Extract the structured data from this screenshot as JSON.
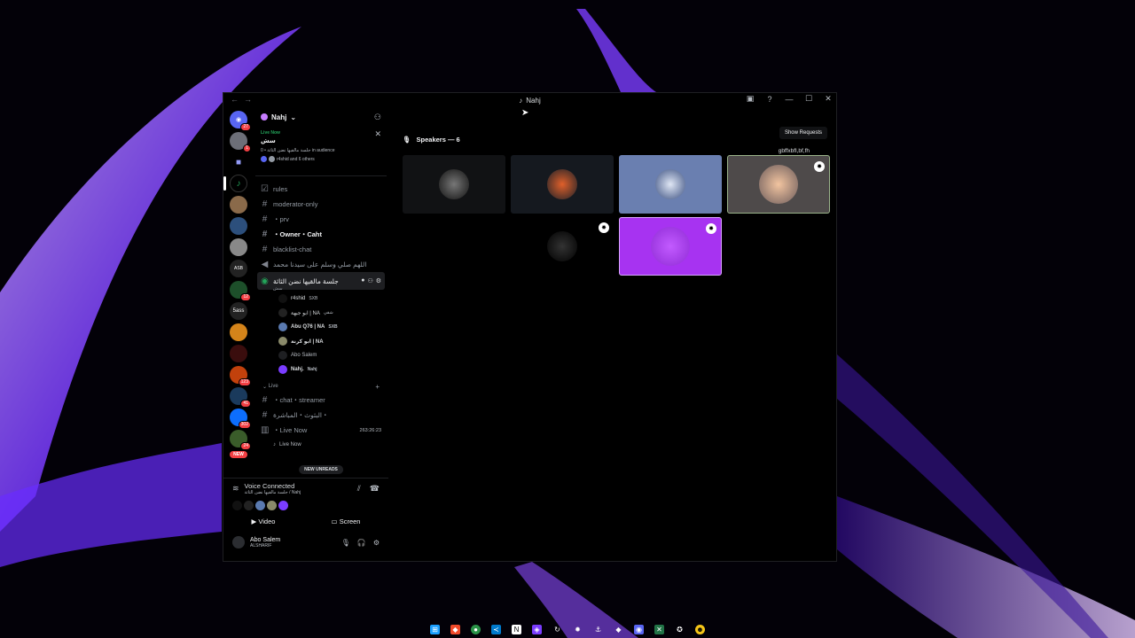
{
  "window": {
    "title": "Nahj"
  },
  "server": {
    "name": "Nahj"
  },
  "live_card": {
    "label": "Live Now",
    "stage_name": "سش",
    "meta": "جلسة مالقيها نضن الثاثة • 0 in audience",
    "others": "r4shid and 6 others"
  },
  "rail": {
    "badges": [
      "27",
      "1",
      "5",
      "12",
      "123",
      "41",
      "302",
      "24"
    ],
    "text_server": "5ass",
    "new_label": "NEW"
  },
  "channels": [
    {
      "icon": "rules",
      "label": "rules"
    },
    {
      "icon": "hash",
      "label": "moderator-only"
    },
    {
      "icon": "hash",
      "label": "・prv"
    },
    {
      "icon": "hash",
      "label": "・Owner・Caht"
    },
    {
      "icon": "hash",
      "label": "blacklist-chat"
    },
    {
      "icon": "hash",
      "label": "اللهم صلي وسلم على سيدنا محمد"
    }
  ],
  "active_channel": {
    "label": "جلسة مالقيها نضن الثاثة",
    "sub": "سش"
  },
  "members": [
    {
      "name": "r4shid",
      "tag": "SXB"
    },
    {
      "name": "ابو جبهة | NA",
      "tag": "شقي"
    },
    {
      "name": "Abu Q76 | NA",
      "tag": "SXB"
    },
    {
      "name": "ابو كرنة | NA",
      "tag": ""
    },
    {
      "name": "Abo Salem",
      "tag": ""
    },
    {
      "name": "Nahj.",
      "tag": "Nahj"
    }
  ],
  "category": {
    "label": "Live"
  },
  "live_channels": [
    {
      "label": "・chat・streamer",
      "timer": ""
    },
    {
      "label": "البثوث・المباشرة・",
      "timer": ""
    },
    {
      "label": "・Live Now",
      "timer": "263:26:23"
    }
  ],
  "live_now_sub": "Live Now",
  "new_unreads": "NEW UNREADS",
  "voice": {
    "title": "Voice Connected",
    "sub": "جلسة مالقيها نضن الثاثة / Nahj",
    "video_label": "Video",
    "screen_label": "Screen"
  },
  "user": {
    "name": "Abo Salem",
    "status": "ALSHARIF"
  },
  "stage": {
    "speakers_label": "Speakers — 6",
    "tooltip": "Show Requests",
    "request_name": "gbffxbfl,bf,fh"
  },
  "colors": {
    "accent": "#5865f2",
    "live": "#23a55a",
    "danger": "#f23f43",
    "purple_tile": "#a733f1"
  }
}
